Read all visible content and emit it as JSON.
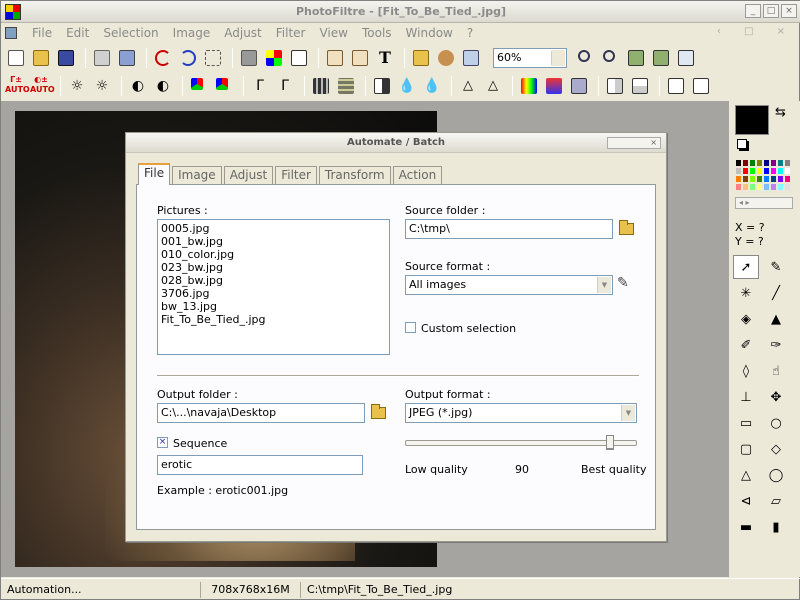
{
  "window": {
    "title": "PhotoFiltre - [Fit_To_Be_Tied_.jpg]",
    "buttons": [
      "_",
      "□",
      "×"
    ]
  },
  "menu": [
    "File",
    "Edit",
    "Selection",
    "Image",
    "Adjust",
    "Filter",
    "View",
    "Tools",
    "Window",
    "?"
  ],
  "toolbar": {
    "zoom": "60%"
  },
  "right_panel": {
    "x_label": "X = ?",
    "y_label": "Y = ?"
  },
  "statusbar": {
    "message": "Automation...",
    "dimensions": "708x768x16M",
    "path": "C:\\tmp\\Fit_To_Be_Tied_.jpg"
  },
  "dialog": {
    "title": "Automate / Batch",
    "tabs": [
      "File",
      "Image",
      "Adjust",
      "Filter",
      "Transform",
      "Action"
    ],
    "active_tab": "File",
    "pictures_label": "Pictures :",
    "pictures": [
      "0005.jpg",
      "001_bw.jpg",
      "010_color.jpg",
      "023_bw.jpg",
      "028_bw.jpg",
      "3706.jpg",
      "bw_13.jpg",
      "Fit_To_Be_Tied_.jpg"
    ],
    "source_folder_label": "Source folder :",
    "source_folder": "C:\\tmp\\",
    "source_format_label": "Source format :",
    "source_format": "All images",
    "custom_selection_label": "Custom selection",
    "custom_selection": false,
    "output_folder_label": "Output folder :",
    "output_folder": "C:\\...\\navaja\\Desktop",
    "output_format_label": "Output format :",
    "output_format": "JPEG (*.jpg)",
    "sequence_label": "Sequence",
    "sequence": true,
    "sequence_name": "erotic",
    "example": "Example : erotic001.jpg",
    "quality_low": "Low quality",
    "quality_value": "90",
    "quality_high": "Best quality",
    "quality_fraction": 0.9
  },
  "palette_colors": [
    "#000000",
    "#800000",
    "#008000",
    "#808000",
    "#000080",
    "#800080",
    "#008080",
    "#808080",
    "#c0c0c0",
    "#ff0000",
    "#00ff00",
    "#ffff00",
    "#0000ff",
    "#ff00ff",
    "#00ffff",
    "#ffffff",
    "#ff8000",
    "#804000",
    "#80ff00",
    "#408000",
    "#0080ff",
    "#004080",
    "#8000ff",
    "#ff0080",
    "#ff8080",
    "#ffc080",
    "#80ff80",
    "#ffff80",
    "#80c0ff",
    "#c080ff",
    "#80ffff",
    "#e0e0e0"
  ]
}
